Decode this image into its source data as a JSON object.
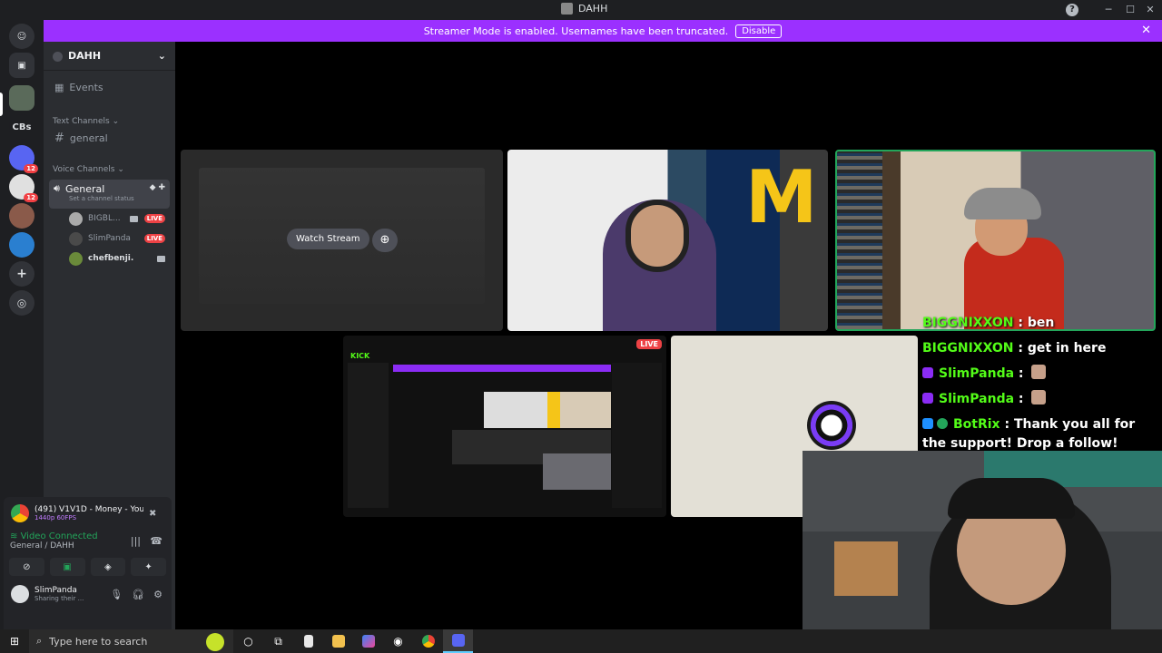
{
  "window": {
    "title": "DAHH"
  },
  "banner": {
    "text": "Streamer Mode is enabled. Usernames have been truncated.",
    "disable_label": "Disable"
  },
  "rail": {
    "servers": [
      {
        "label": "CBs"
      }
    ],
    "badges": [
      "12",
      "12"
    ]
  },
  "sidebar": {
    "guild_name": "DAHH",
    "events_label": "Events",
    "text_category": "Text Channels",
    "text_channels": [
      "general"
    ],
    "voice_category": "Voice Channels",
    "voice_channel": {
      "name": "General",
      "status_placeholder": "Set a channel status"
    },
    "voice_users": [
      {
        "name": "BIGBL...",
        "live": "LIVE"
      },
      {
        "name": "SlimPanda",
        "live": "LIVE"
      },
      {
        "name": "chefbenji.",
        "live": ""
      }
    ]
  },
  "voice_panel": {
    "stream_title": "(491) V1V1D - Money - YouT...",
    "stream_quality": "1440p 60FPS",
    "connection_status": "Video Connected",
    "connection_location": "General / DAHH",
    "user_name": "SlimPanda",
    "user_status": "Sharing their ..."
  },
  "stage": {
    "watch_label": "Watch Stream",
    "live_label": "LIVE",
    "kick_label": "KICK"
  },
  "overlay_chat": [
    {
      "user": "BIGGNIXXON",
      "sep": " : ",
      "msg": "ben",
      "icons": []
    },
    {
      "user": "BIGGNIXXON",
      "sep": " : ",
      "msg": "get in here",
      "icons": []
    },
    {
      "user": "SlimPanda",
      "sep": " : ",
      "msg": "",
      "icons": [
        "badge"
      ]
    },
    {
      "user": "SlimPanda",
      "sep": " : ",
      "msg": "",
      "icons": [
        "badge"
      ]
    },
    {
      "user": "BotRix",
      "sep": " : ",
      "msg": "Thank you all for the support! Drop a follow!",
      "icons": [
        "bot",
        "verified"
      ]
    }
  ],
  "taskbar": {
    "search_placeholder": "Type here to search"
  },
  "colors": {
    "streamer_banner": "#9b30ff",
    "live": "#ed4245",
    "connected": "#23a55a",
    "kick_green": "#53fc18"
  }
}
